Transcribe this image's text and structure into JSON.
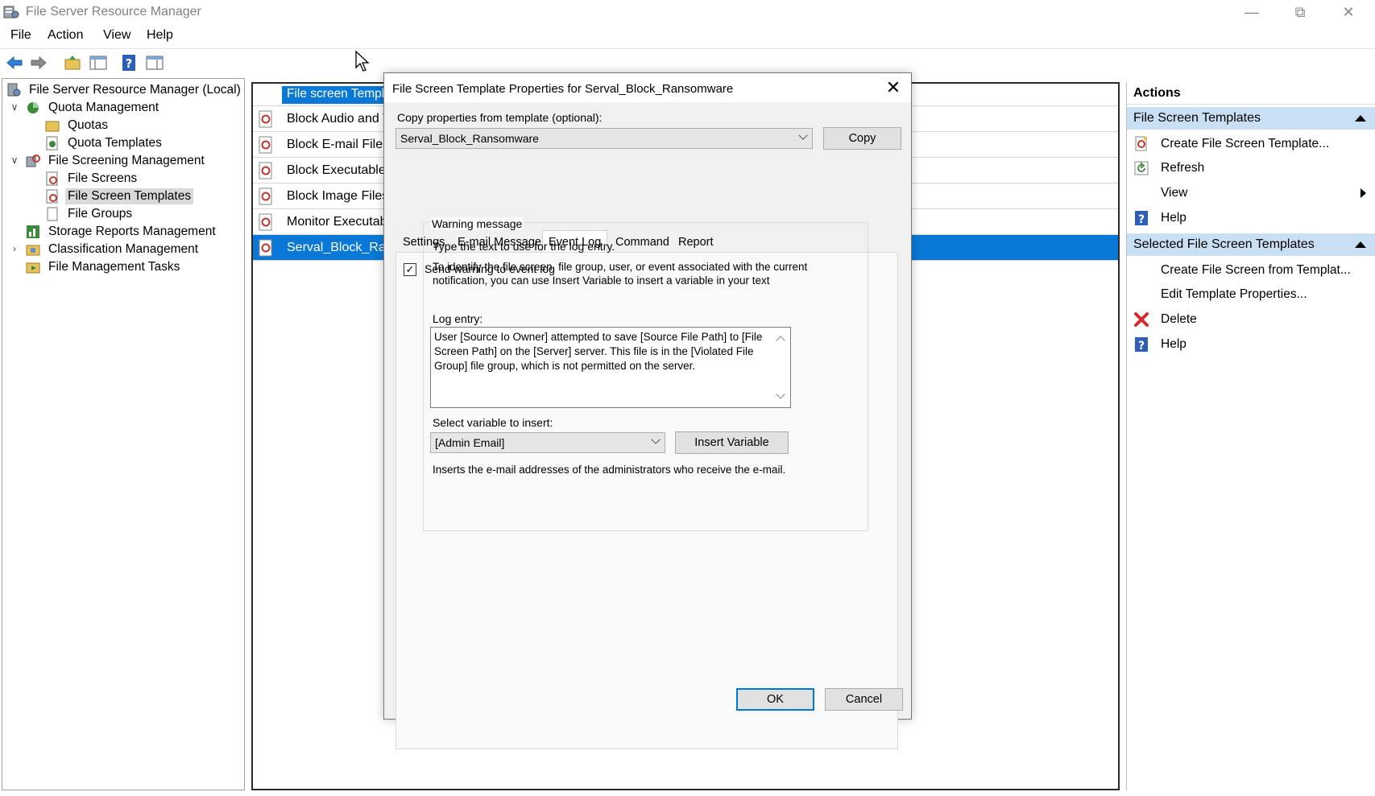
{
  "window": {
    "title": "File Server Resource Manager",
    "controls": {
      "minimize": "minimize-icon",
      "restore": "restore-icon",
      "close": "close-icon"
    }
  },
  "menu": [
    "File",
    "Action",
    "View",
    "Help"
  ],
  "toolbar": [
    "back-arrow-icon",
    "forward-arrow-icon",
    "up-folder-icon",
    "show-hide-console-tree-icon",
    "help-icon",
    "properties-icon"
  ],
  "tree": {
    "root": "File Server Resource Manager (Local)",
    "quota_management": "Quota Management",
    "quotas": "Quotas",
    "quota_templates": "Quota Templates",
    "file_screening_management": "File Screening Management",
    "file_screens": "File Screens",
    "file_screen_templates": "File Screen Templates",
    "file_groups": "File Groups",
    "storage_reports": "Storage Reports Management",
    "classification": "Classification Management",
    "file_management_tasks": "File Management Tasks"
  },
  "list": {
    "column_header": "File screen Templ",
    "rows": [
      "Block Audio and V",
      "Block E-mail Files",
      "Block Executable",
      "Block Image Files",
      "Monitor Executab",
      "Serval_Block_Rans"
    ]
  },
  "actions": {
    "header": "Actions",
    "section1": "File Screen Templates",
    "create": "Create File Screen Template...",
    "refresh": "Refresh",
    "view": "View",
    "help1": "Help",
    "section2": "Selected File Screen Templates",
    "create_from": "Create File Screen from Templat...",
    "edit": "Edit Template Properties...",
    "delete": "Delete",
    "help2": "Help"
  },
  "dialog": {
    "title": "File Screen Template Properties for Serval_Block_Ransomware",
    "copy_label": "Copy properties from template (optional):",
    "copy_value": "Serval_Block_Ransomware",
    "copy_button": "Copy",
    "tabs": [
      "Settings",
      "E-mail Message",
      "Event Log",
      "Command",
      "Report"
    ],
    "active_tab": "Event Log",
    "send_warning": "Send warning to event log",
    "send_warning_checked": true,
    "group_title": "Warning message",
    "type_text": "Type the text to use for the log entry.",
    "identify_text_line1": "To identify the file screen, file group, user, or event associated with the current",
    "identify_text_line2": "notification, you can use Insert Variable to insert a variable in your text",
    "log_entry_label": "Log entry:",
    "log_entry": "User [Source Io Owner] attempted to save [Source File Path] to [File Screen Path] on the [Server] server. This file is in the [Violated File Group] file group, which is not permitted on the server.",
    "select_variable_label": "Select variable to insert:",
    "variable_value": "[Admin Email]",
    "insert_button": "Insert Variable",
    "variable_desc": "Inserts the e-mail addresses of the administrators who receive the e-mail.",
    "ok": "OK",
    "cancel": "Cancel"
  },
  "colors": {
    "selection": "#0a78d7",
    "section_bg": "#c9dff3",
    "dialog_bg": "#f0f0f0"
  }
}
